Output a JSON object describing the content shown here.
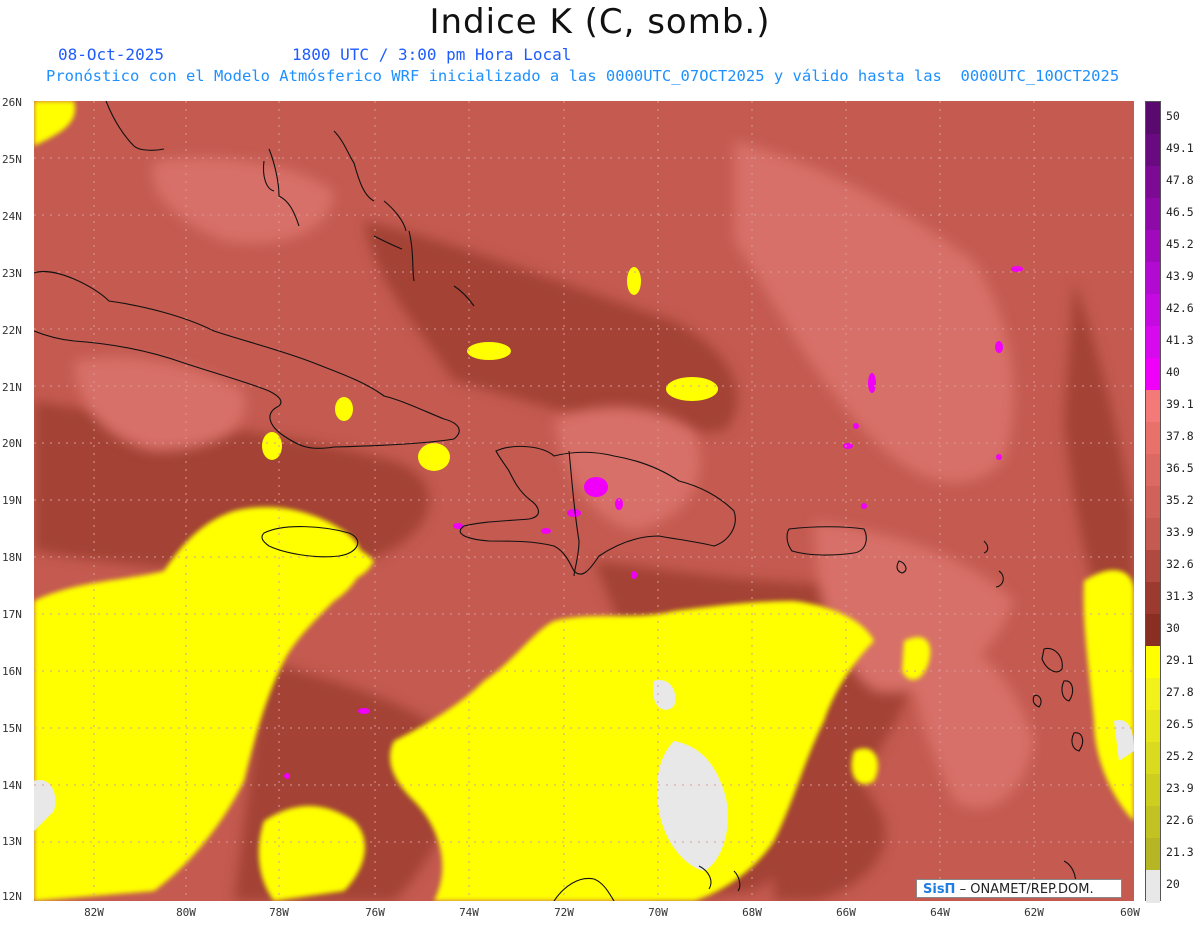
{
  "header": {
    "title": "Indice K (C, somb.)",
    "date": "08-Oct-2025",
    "time": "1800 UTC / 3:00 pm Hora Local",
    "forecast_line": "Pronóstico con el Modelo Atmósferico WRF inicializado a las 0000UTC_07OCT2025 y válido hasta las  0000UTC_10OCT2025"
  },
  "axes": {
    "lat_labels": [
      "26N",
      "25N",
      "24N",
      "23N",
      "22N",
      "21N",
      "20N",
      "19N",
      "18N",
      "17N",
      "16N",
      "15N",
      "14N",
      "13N",
      "12N"
    ],
    "lon_labels": [
      "82W",
      "80W",
      "78W",
      "76W",
      "74W",
      "72W",
      "70W",
      "68W",
      "66W",
      "64W",
      "62W",
      "60W"
    ]
  },
  "colorbar": {
    "labels": [
      "50",
      "49.1",
      "47.8",
      "46.5",
      "45.2",
      "43.9",
      "42.6",
      "41.3",
      "40",
      "39.1",
      "37.8",
      "36.5",
      "35.2",
      "33.9",
      "32.6",
      "31.3",
      "30",
      "29.1",
      "27.8",
      "26.5",
      "25.2",
      "23.9",
      "22.6",
      "21.3",
      "20"
    ],
    "colors": [
      "#5a0a6e",
      "#6a0a80",
      "#7c0a94",
      "#8e0aa8",
      "#a00abc",
      "#b20ad0",
      "#c40ae0",
      "#d60aec",
      "#f000f8",
      "#f47a7a",
      "#e8716a",
      "#dc6a62",
      "#d0625a",
      "#c45a50",
      "#b04a40",
      "#9c3a30",
      "#8a2e24",
      "#ffff00",
      "#f2f21a",
      "#e6e61c",
      "#dada1e",
      "#cece20",
      "#c2c222",
      "#b6b624",
      "#e8e8e8"
    ]
  },
  "credit": {
    "brand": "SisΠ",
    "text": "– ONAMET/REP.DOM."
  }
}
